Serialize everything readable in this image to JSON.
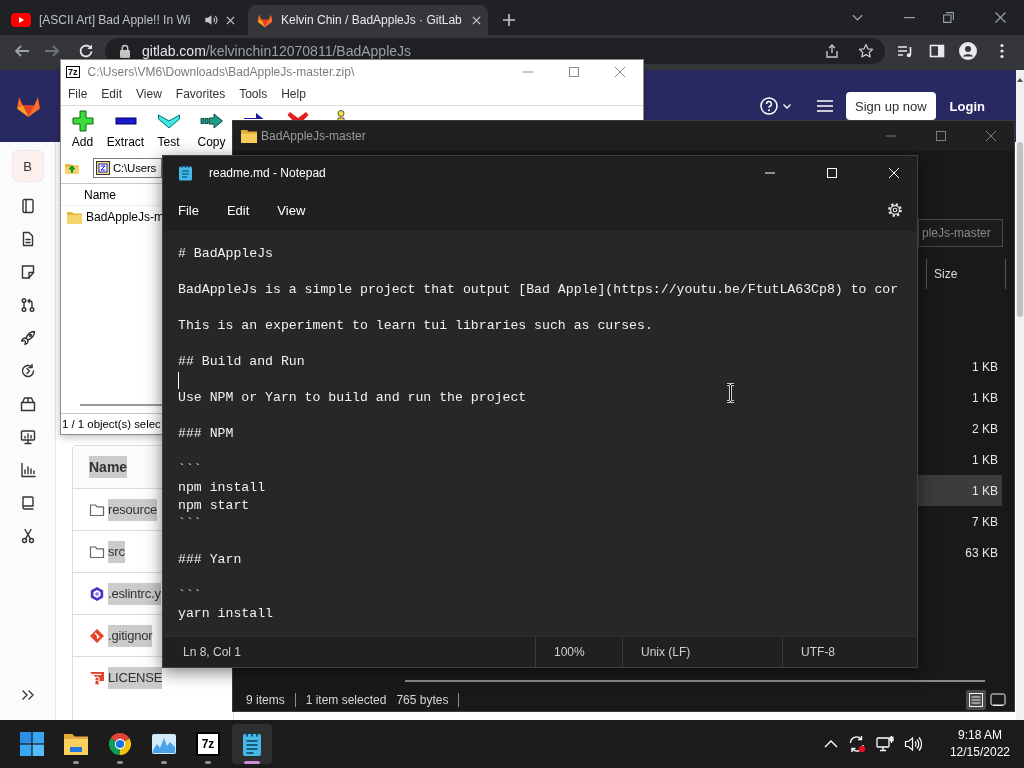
{
  "browser": {
    "tabs": [
      {
        "title": "[ASCII Art] Bad Apple!! In Wi",
        "selected": false,
        "playing_audio": true
      },
      {
        "title": "Kelvin Chin / BadAppleJs · GitLab",
        "selected": true,
        "playing_audio": false
      }
    ],
    "address": {
      "host": "gitlab.com",
      "path": "/kelvinchin12070811/BadAppleJs"
    }
  },
  "gitlab": {
    "header": {
      "signup": "Sign up now",
      "login": "Login"
    },
    "sidebar": {
      "avatar": "B"
    },
    "files": {
      "header": {
        "label": "Name",
        "highlighted": true
      },
      "rows": [
        {
          "name": "resource",
          "kind": "folder",
          "highlighted": true
        },
        {
          "name": "src",
          "kind": "folder",
          "highlighted": true
        },
        {
          "name": ".eslintrc.y",
          "kind": "eslint",
          "highlighted": true
        },
        {
          "name": ".gitignor",
          "kind": "git",
          "highlighted": true
        },
        {
          "name": "LICENSE",
          "kind": "license",
          "highlighted": true
        }
      ]
    }
  },
  "sevenzip": {
    "logo": "7z",
    "title": "C:\\Users\\VM6\\Downloads\\BadAppleJs-master.zip\\",
    "menu": [
      "File",
      "Edit",
      "View",
      "Favorites",
      "Tools",
      "Help"
    ],
    "toolbar": [
      {
        "kind": "add",
        "label": "Add"
      },
      {
        "kind": "extract",
        "label": "Extract"
      },
      {
        "kind": "test",
        "label": "Test"
      },
      {
        "kind": "copy",
        "label": "Copy"
      },
      {
        "kind": "move"
      },
      {
        "kind": "delete"
      },
      {
        "kind": "info"
      }
    ],
    "path": "C:\\Users",
    "column": "Name",
    "rows": [
      {
        "name": "BadAppleJs-m"
      }
    ],
    "status": "1 / 1 object(s) selec"
  },
  "explorer": {
    "title": "BadAppleJs-master",
    "search": {
      "placeholder": "pleJs-master"
    },
    "column": "Size",
    "rows": [
      {
        "size": "1 KB",
        "selected": false
      },
      {
        "size": "1 KB",
        "selected": false
      },
      {
        "size": "2 KB",
        "selected": false
      },
      {
        "size": "1 KB",
        "selected": false
      },
      {
        "size": "1 KB",
        "selected": true
      },
      {
        "size": "7 KB",
        "selected": false
      },
      {
        "size": "63 KB",
        "selected": false
      }
    ],
    "status": {
      "items": "9 items",
      "selection": "1 item selected",
      "bytes": "765 bytes"
    },
    "views": [
      {
        "kind": "details",
        "selected": true
      },
      {
        "kind": "tiles",
        "selected": false
      }
    ]
  },
  "notepad": {
    "title": "readme.md - Notepad",
    "menu": [
      "File",
      "Edit",
      "View"
    ],
    "paragraphs": [
      {
        "lines": [
          "# BadAppleJs"
        ]
      },
      {
        "lines": [
          "BadAppleJs is a simple project that output [Bad Apple](https://youtu.be/FtutLA63Cp8) to cor"
        ]
      },
      {
        "lines": [
          "This is an experiment to learn tui libraries such as curses."
        ]
      },
      {
        "lines": [
          "## Build and Run"
        ]
      },
      {
        "lines": [
          "Use NPM or Yarn to build and run the project"
        ],
        "caret_above": true
      },
      {
        "lines": [
          "### NPM"
        ]
      },
      {
        "lines": [
          "```",
          "npm install",
          "npm start",
          "```"
        ]
      },
      {
        "lines": [
          "### Yarn"
        ]
      },
      {
        "lines": [
          "```",
          "yarn install"
        ]
      }
    ],
    "status": [
      "Ln 8, Col 1",
      "100%",
      "Unix (LF)",
      "UTF-8"
    ]
  },
  "taskbar": {
    "apps": [
      {
        "kind": "start",
        "selected": false
      },
      {
        "kind": "folder",
        "open": true,
        "selected": false
      },
      {
        "kind": "browser",
        "open": true,
        "selected": false
      },
      {
        "kind": "graph",
        "open": true,
        "selected": false
      },
      {
        "kind": "archive",
        "logo": "7z",
        "open": true,
        "selected": false
      },
      {
        "kind": "notepad",
        "open": true,
        "selected": true
      }
    ],
    "clock": {
      "time": "9:18 AM",
      "date": "12/15/2022"
    }
  }
}
